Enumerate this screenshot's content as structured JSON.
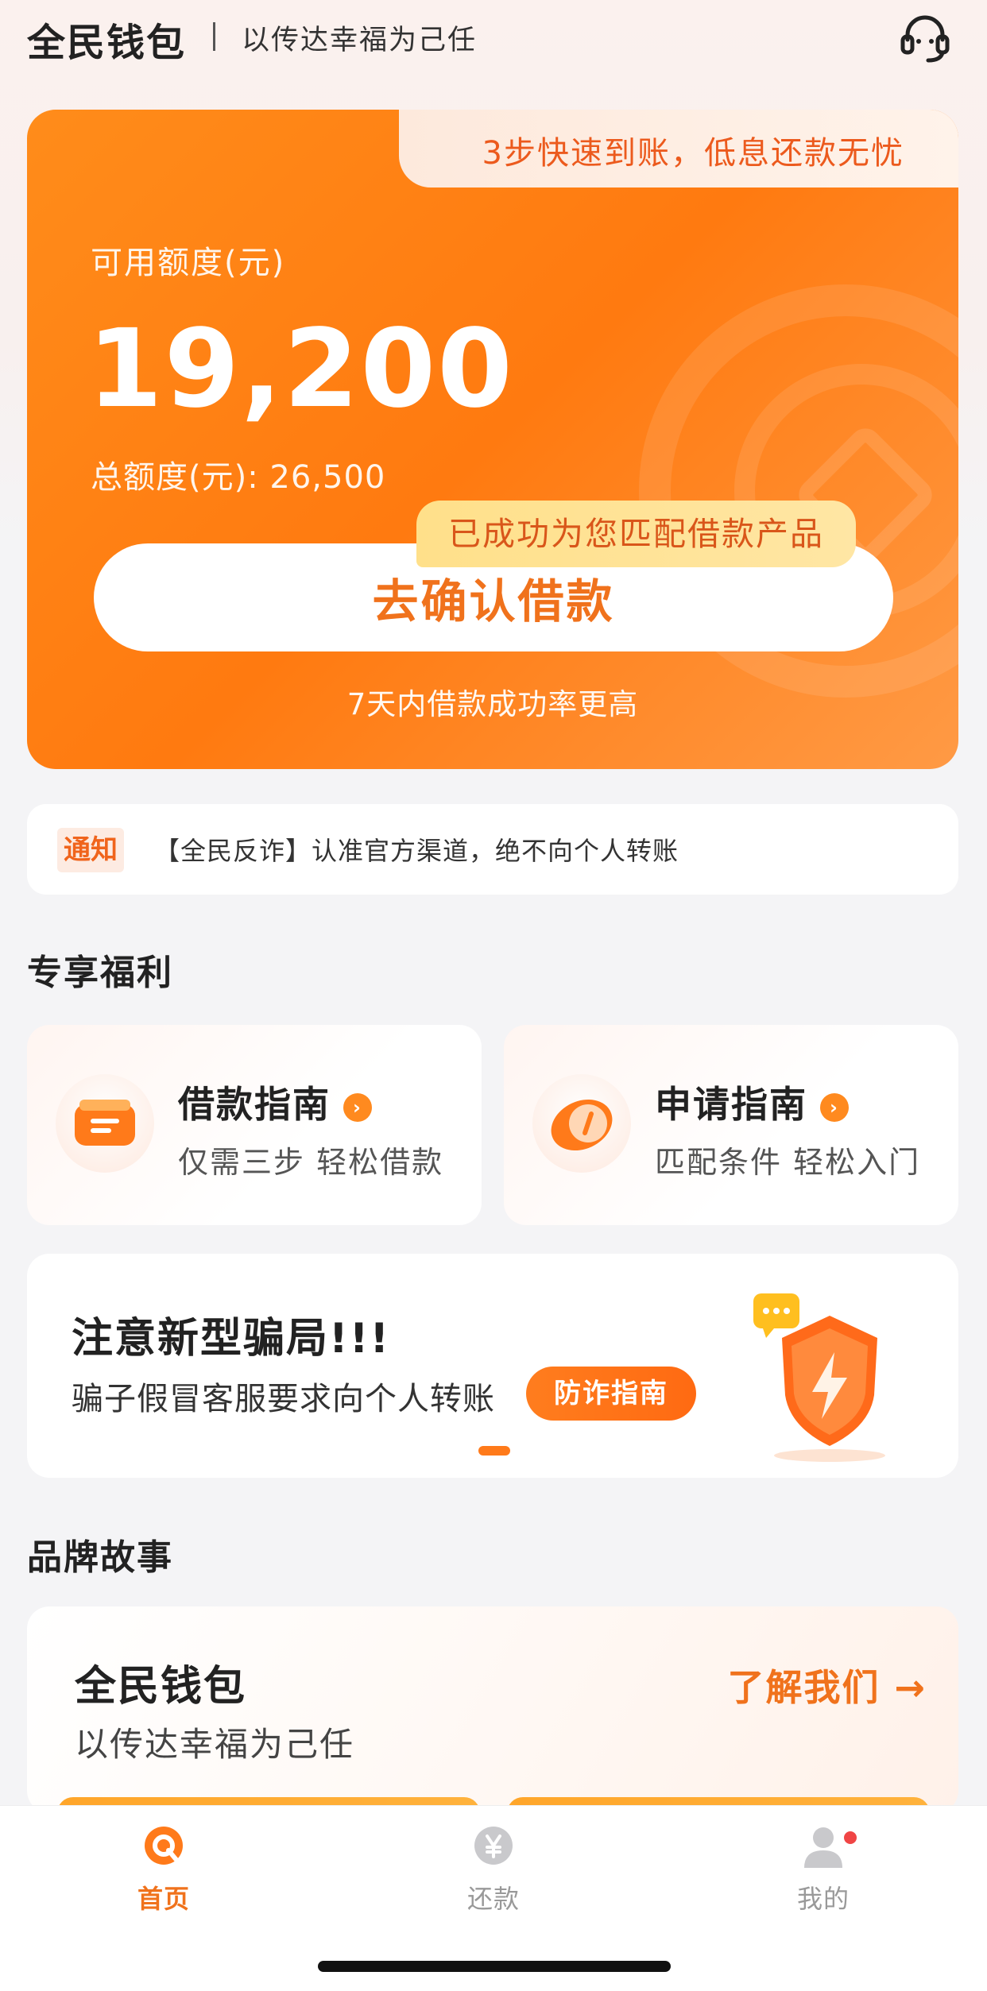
{
  "header": {
    "logo": "全民钱包",
    "slogan": "以传达幸福为己任",
    "customer_service_icon": "headset-icon"
  },
  "hero": {
    "tab_text": "3步快速到账，低息还款无忧",
    "available_label": "可用额度(元)",
    "available_amount": "19,200",
    "total_label": "总额度(元): 26,500",
    "match_badge": "已成功为您匹配借款产品",
    "confirm_button": "去确认借款",
    "footnote": "7天内借款成功率更高",
    "accent_color": "#ff7a10"
  },
  "notice": {
    "tag": "通知",
    "text": "【全民反诈】认准官方渠道，绝不向个人转账"
  },
  "benefits": {
    "title": "专享福利",
    "items": [
      {
        "title": "借款指南",
        "subtitle": "仅需三步 轻松借款",
        "icon": "loan-guide-icon"
      },
      {
        "title": "申请指南",
        "subtitle": "匹配条件 轻松入门",
        "icon": "compass-icon"
      }
    ]
  },
  "banner": {
    "title": "注意新型骗局!!!",
    "subtitle": "骗子假冒客服要求向个人转账",
    "button": "防诈指南",
    "icon": "shield-lightning-icon"
  },
  "brand": {
    "section_title": "品牌故事",
    "name": "全民钱包",
    "slogan": "以传达幸福为己任",
    "link": "了解我们 →"
  },
  "tabbar": {
    "items": [
      {
        "label": "首页",
        "icon": "home-icon",
        "active": true
      },
      {
        "label": "还款",
        "icon": "yuan-icon",
        "active": false
      },
      {
        "label": "我的",
        "icon": "user-icon",
        "active": false,
        "has_badge": true
      }
    ]
  }
}
